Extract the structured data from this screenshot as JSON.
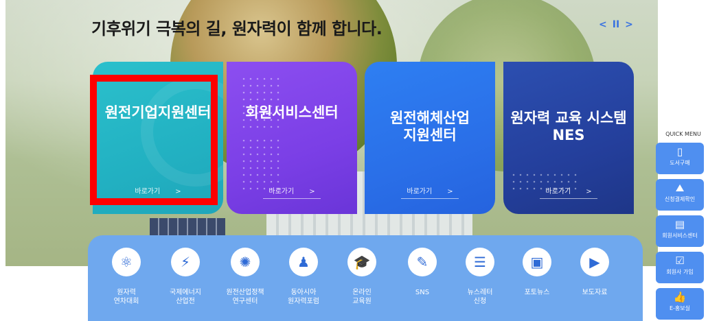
{
  "headline": "기후위기 극복의 길, 원자력이 함께 합니다.",
  "slider": {
    "prev": "<",
    "pause": "II",
    "next": ">"
  },
  "cards": [
    {
      "title": "원전기업지원센터",
      "link": "바로가기"
    },
    {
      "title": "회원서비스센터",
      "link": "바로가기"
    },
    {
      "title": "원전해체산업\n지원센터",
      "link": "바로가기"
    },
    {
      "title": "원자력 교육 시스템\nNES",
      "link": "바로가기"
    }
  ],
  "arrow": ">",
  "iconbar": [
    {
      "icon": "atom-icon",
      "glyph": "⚛",
      "label": "원자력\n연차대회"
    },
    {
      "icon": "energy-icon",
      "glyph": "⚡",
      "label": "국제에너지\n산업전"
    },
    {
      "icon": "policy-icon",
      "glyph": "✺",
      "label": "원전산업정책\n연구센터"
    },
    {
      "icon": "forum-icon",
      "glyph": "♟",
      "label": "동아시아\n원자력포럼"
    },
    {
      "icon": "online-edu-icon",
      "glyph": "🎓",
      "label": "온라인\n교육원"
    },
    {
      "icon": "sns-icon",
      "glyph": "✎",
      "label": "SNS"
    },
    {
      "icon": "newsletter-icon",
      "glyph": "☰",
      "label": "뉴스레터\n신청"
    },
    {
      "icon": "photo-news-icon",
      "glyph": "▣",
      "label": "포토뉴스"
    },
    {
      "icon": "press-icon",
      "glyph": "▶",
      "label": "보도자료"
    }
  ],
  "quick_menu": {
    "title": "QUICK MENU",
    "items": [
      {
        "icon": "book-icon",
        "glyph": "▯",
        "label": "도서구매"
      },
      {
        "icon": "map-icon",
        "glyph": "⛰",
        "label": "신청결제확인"
      },
      {
        "icon": "member-card-icon",
        "glyph": "▤",
        "label": "회원서비스센터"
      },
      {
        "icon": "check-icon",
        "glyph": "☑",
        "label": "회원사 가입"
      },
      {
        "icon": "thumbs-up-icon",
        "glyph": "👍",
        "label": "E-홍보실"
      }
    ]
  },
  "colors": {
    "card1": "#22b1c2",
    "card2": "#7b3fe6",
    "card3": "#2a6fe8",
    "card4": "#243f9c",
    "iconbar": "#6fa8ee",
    "quick_menu": "#4f8ff0",
    "highlight": "#ff0000"
  }
}
